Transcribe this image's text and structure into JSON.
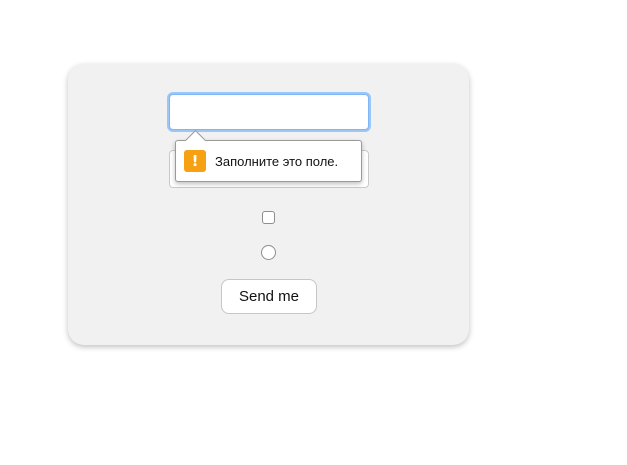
{
  "form": {
    "text_field": {
      "value": "",
      "placeholder": ""
    },
    "validation_tooltip": {
      "icon": "warning-icon",
      "icon_glyph": "!",
      "icon_color": "#f6a114",
      "message": "Заполните это поле."
    },
    "checkbox": {
      "checked": false
    },
    "radio": {
      "selected": false
    },
    "submit_label": "Send me"
  },
  "colors": {
    "card_background": "#f1f1f1",
    "focus_ring": "#9cc6f6",
    "warning": "#f6a114"
  }
}
